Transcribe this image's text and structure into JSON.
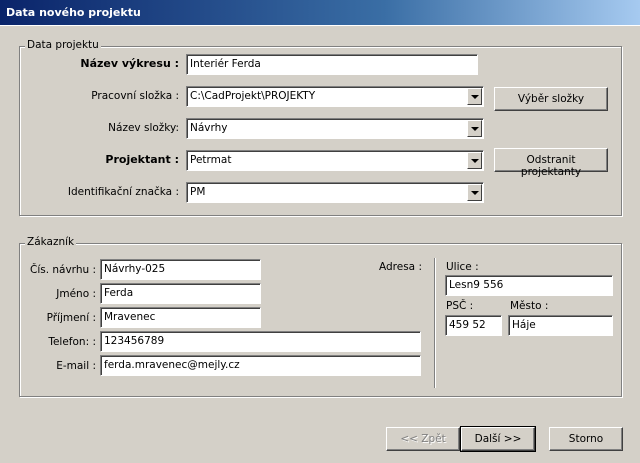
{
  "window": {
    "title": "Data nového projektu"
  },
  "project": {
    "legend": "Data projektu",
    "drawing_name": {
      "label": "Název výkresu :",
      "value": "Interiér Ferda"
    },
    "work_folder": {
      "label": "Pracovní složka :",
      "value": "C:\\CadProjekt\\PROJEKTY"
    },
    "folder_name": {
      "label": "Název složky:",
      "value": "Návrhy"
    },
    "designer": {
      "label": "Projektant :",
      "value": "Petrmat"
    },
    "id_mark": {
      "label": "Identifikační značka :",
      "value": "PM"
    },
    "select_folder_button": "Výběr složky",
    "remove_designers_button": "Odstranit projektanty"
  },
  "customer": {
    "legend": "Zákazník",
    "design_no": {
      "label": "Čís. návrhu :",
      "value": "Návrhy-025"
    },
    "first_name": {
      "label": "Jméno :",
      "value": "Ferda"
    },
    "last_name": {
      "label": "Příjmení :",
      "value": "Mravenec"
    },
    "phone": {
      "label": "Telefon: :",
      "value": "123456789"
    },
    "email": {
      "label": "E-mail :",
      "value": "ferda.mravenec@mejly.cz"
    },
    "address": {
      "label": "Adresa :",
      "street_label": "Ulice :",
      "street": "Lesn9 556",
      "zip_label": "PSČ :",
      "zip": "459 52",
      "city_label": "Město :",
      "city": "Háje"
    }
  },
  "footer": {
    "back_button": "<< Zpět",
    "next_button": "Další >>",
    "cancel_button": "Storno"
  }
}
